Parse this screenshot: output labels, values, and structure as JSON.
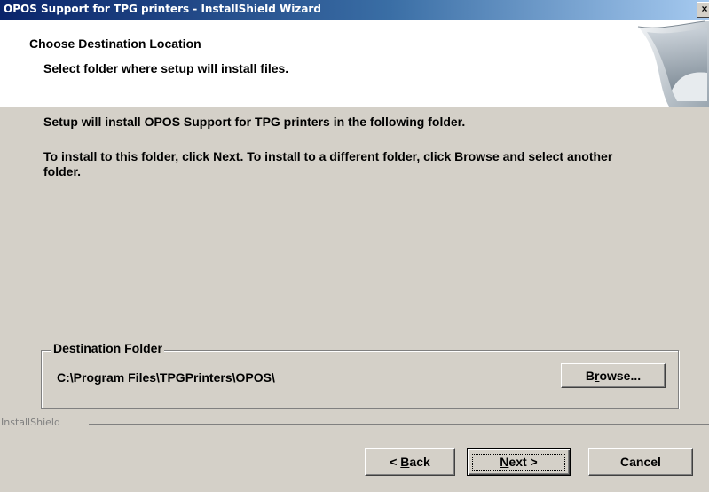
{
  "window": {
    "title": "OPOS Support for TPG printers - InstallShield Wizard",
    "close_glyph": "×"
  },
  "header": {
    "title": "Choose Destination Location",
    "subtitle": "Select folder where setup will install files."
  },
  "body": {
    "line1": "Setup will install OPOS Support for TPG printers in the following folder.",
    "line2": "To install to this folder, click Next. To install to a different folder, click Browse and select another folder."
  },
  "destination": {
    "group_label": "Destination Folder",
    "path": "C:\\Program Files\\TPGPrinters\\OPOS\\",
    "browse": {
      "pre": "B",
      "mnemonic": "r",
      "post": "owse..."
    }
  },
  "footer": {
    "brand": "InstallShield",
    "back": {
      "pre": "< ",
      "mnemonic": "B",
      "post": "ack"
    },
    "next": {
      "pre": "",
      "mnemonic": "N",
      "post": "ext >"
    },
    "cancel": "Cancel"
  },
  "colors": {
    "titlebar_start": "#0a246a",
    "titlebar_end": "#a6caf0",
    "dialog_bg": "#d4d0c8"
  }
}
